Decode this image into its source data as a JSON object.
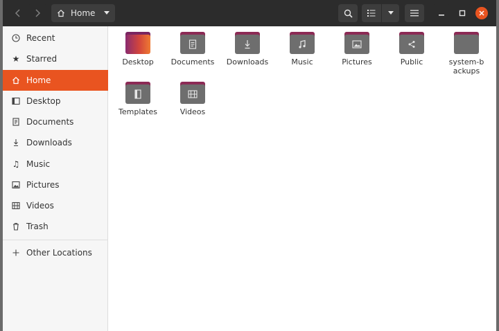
{
  "header": {
    "location_label": "Home"
  },
  "sidebar": {
    "items": [
      {
        "label": "Recent",
        "icon": "clock-icon"
      },
      {
        "label": "Starred",
        "icon": "star-icon"
      },
      {
        "label": "Home",
        "icon": "home-icon",
        "active": true
      },
      {
        "label": "Desktop",
        "icon": "desktop-icon"
      },
      {
        "label": "Documents",
        "icon": "document-icon"
      },
      {
        "label": "Downloads",
        "icon": "download-icon"
      },
      {
        "label": "Music",
        "icon": "music-icon"
      },
      {
        "label": "Pictures",
        "icon": "picture-icon"
      },
      {
        "label": "Videos",
        "icon": "video-icon"
      },
      {
        "label": "Trash",
        "icon": "trash-icon"
      }
    ],
    "other_locations": "Other Locations"
  },
  "files": [
    {
      "label": "Desktop",
      "icon": "desktop-folder-icon"
    },
    {
      "label": "Documents",
      "icon": "documents-folder-icon"
    },
    {
      "label": "Downloads",
      "icon": "downloads-folder-icon"
    },
    {
      "label": "Music",
      "icon": "music-folder-icon"
    },
    {
      "label": "Pictures",
      "icon": "pictures-folder-icon"
    },
    {
      "label": "Public",
      "icon": "public-folder-icon"
    },
    {
      "label": "system-backups",
      "icon": "folder-icon"
    },
    {
      "label": "Templates",
      "icon": "templates-folder-icon"
    },
    {
      "label": "Videos",
      "icon": "videos-folder-icon"
    }
  ],
  "colors": {
    "accent": "#e95420",
    "headerbar": "#2c2c2c",
    "folder_body": "#6e6e6e",
    "folder_tab": "#8c2a55"
  }
}
